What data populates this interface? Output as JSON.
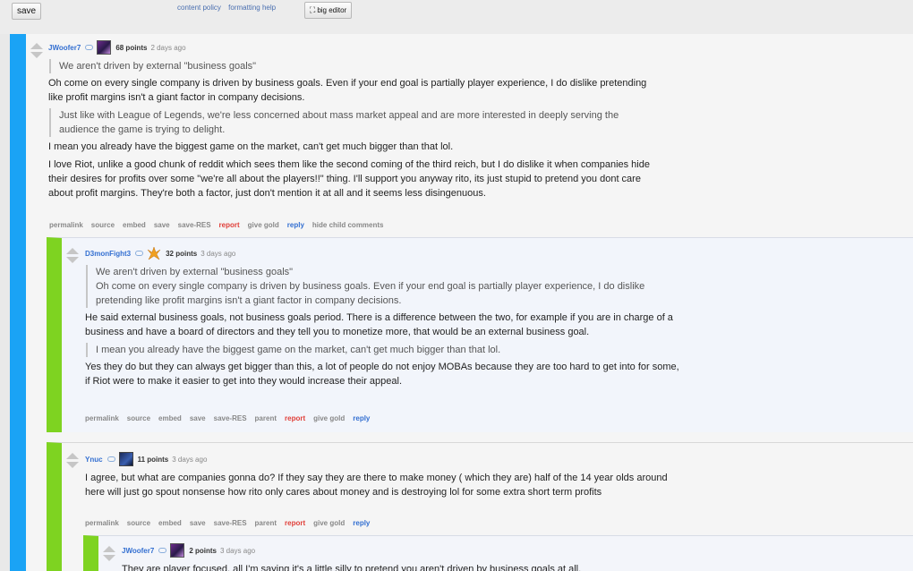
{
  "topbar": {
    "save_label": "save",
    "links": [
      "content policy",
      "formatting help"
    ],
    "big_editor_label": "big editor"
  },
  "comments": [
    {
      "author": "JWoofer7",
      "points": "68 points",
      "time": "2 days ago",
      "quote1": "We aren't driven by external \"business goals\"",
      "para1": "Oh come on every single company is driven by business goals. Even if your end goal is partially player experience, I do dislike pretending like profit margins isn't a giant factor in company decisions.",
      "quote2": "Just like with League of Legends, we're less concerned about mass market appeal and are more interested in deeply serving the audience the game is trying to delight.",
      "para2": "I mean you already have the biggest game on the market, can't get much bigger than that lol.",
      "para3": "I love Riot, unlike a good chunk of reddit which sees them like the second coming of the third reich, but I do dislike it when companies hide their desires for profits over some \"we're all about the players!!\" thing. I'll support you anyway rito, its just stupid to pretend you dont care about profit margins. They're both a factor, just don't mention it at all and it seems less disingenuous.",
      "actions": [
        "permalink",
        "source",
        "embed",
        "save",
        "save-RES",
        "report",
        "give gold",
        "reply",
        "hide child comments"
      ]
    },
    {
      "author": "D3monFight3",
      "points": "32 points",
      "time": "3 days ago",
      "quote1": "We aren't driven by external \"business goals\"",
      "quote1b": "Oh come on every single company is driven by business goals. Even if your end goal is partially player experience, I do dislike pretending like profit margins isn't a giant factor in company decisions.",
      "para1": "He said external business goals, not business goals period. There is a difference between the two, for example if you are in charge of a business and have a board of directors and they tell you to monetize more, that would be an external business goal.",
      "quote2": "I mean you already have the biggest game on the market, can't get much bigger than that lol.",
      "para2": "Yes they do but they can always get bigger than this, a lot of people do not enjoy MOBAs because they are too hard to get into for some, if Riot were to make it easier to get into they would increase their appeal.",
      "actions": [
        "permalink",
        "source",
        "embed",
        "save",
        "save-RES",
        "parent",
        "report",
        "give gold",
        "reply"
      ]
    },
    {
      "author": "Ynuc",
      "points": "11 points",
      "time": "3 days ago",
      "para1": "I agree, but what are companies gonna do? If they say they are there to make money ( which they are) half of the 14 year olds around here will just go spout nonsense how rito only cares about money and is destroying lol for some extra short term profits",
      "actions": [
        "permalink",
        "source",
        "embed",
        "save",
        "save-RES",
        "parent",
        "report",
        "give gold",
        "reply"
      ]
    },
    {
      "author": "JWoofer7",
      "points": "2 points",
      "time": "3 days ago",
      "para1": "They are player focused, all I'm saying it's a little silly to pretend you aren't driven by business goals at all."
    }
  ],
  "colors": {
    "level1_bar": "#1aa3f5",
    "level2_bar": "#7ed321",
    "author_link": "#336fd1",
    "report_link": "#e0403a"
  }
}
